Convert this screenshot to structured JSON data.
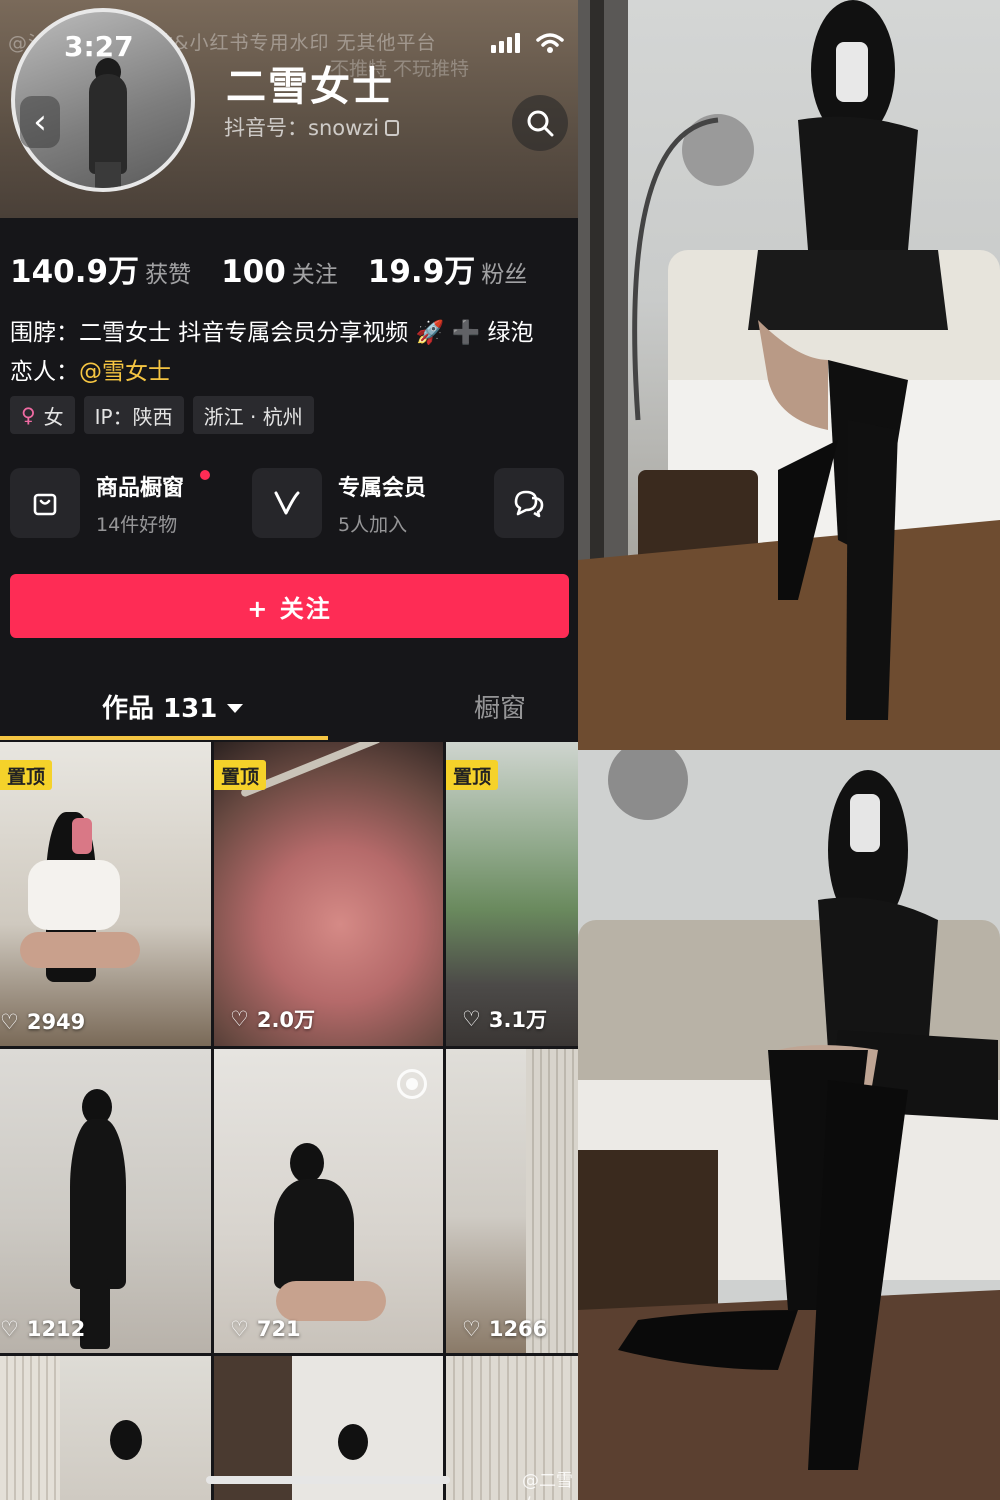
{
  "status_bar": {
    "time": "3:27"
  },
  "profile": {
    "name": "二雪女士",
    "douyin_id": "抖音号：snowzi",
    "watermark_line1": "@沙拉&微博&B站&小红书专用水印 无其他平台",
    "watermark_line2": "不推特 不玩推特"
  },
  "stats": [
    {
      "value": "140.9万",
      "label": "获赞"
    },
    {
      "value": "100",
      "label": "关注"
    },
    {
      "value": "19.9万",
      "label": "粉丝"
    }
  ],
  "bio": {
    "line1": "围脖：二雪女士  抖音专属会员分享视频 🚀 ➕ 绿泡",
    "line2_prefix": "恋人：",
    "line2_mention": "@雪女士"
  },
  "tags": {
    "gender": "女",
    "ip": "IP：陕西",
    "location": "浙江 · 杭州"
  },
  "features": {
    "shop": {
      "title": "商品橱窗",
      "sub": "14件好物"
    },
    "member": {
      "title": "专属会员",
      "sub": "5人加入"
    }
  },
  "follow_button": {
    "label": "+ 关注"
  },
  "tabs": {
    "works": "作品 131",
    "shop": "橱窗"
  },
  "videos": [
    {
      "pinned": "置顶",
      "likes": "2949"
    },
    {
      "pinned": "置顶",
      "likes": "2.0万"
    },
    {
      "pinned": "置顶",
      "likes": "3.1万"
    },
    {
      "pinned": "",
      "likes": "1212"
    },
    {
      "pinned": "",
      "likes": "721"
    },
    {
      "pinned": "",
      "likes": "1266"
    }
  ],
  "corner_watermark": "@二雪女",
  "colors": {
    "accent": "#fe2c55",
    "highlight": "#f5c542",
    "pin": "#f5d22a"
  }
}
